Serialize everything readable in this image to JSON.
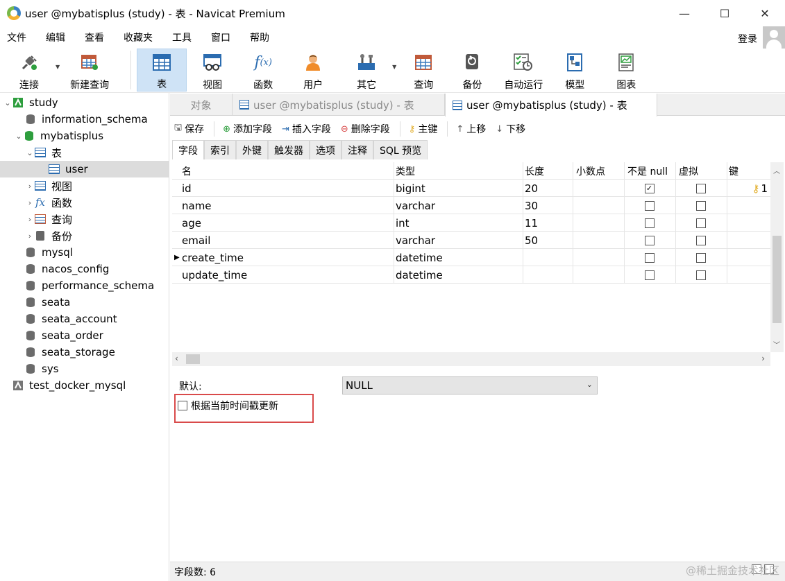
{
  "window": {
    "title": "user @mybatisplus (study) - 表 - Navicat Premium",
    "minimize": "—",
    "maximize": "☐",
    "close": "✕"
  },
  "menu": {
    "items": [
      "文件",
      "编辑",
      "查看",
      "收藏夹",
      "工具",
      "窗口",
      "帮助"
    ],
    "login": "登录"
  },
  "toolbar": {
    "connect": "连接",
    "new_query": "新建查询",
    "table": "表",
    "view": "视图",
    "function": "函数",
    "user": "用户",
    "other": "其它",
    "query": "查询",
    "backup": "备份",
    "autorun": "自动运行",
    "model": "模型",
    "chart": "图表"
  },
  "tree": {
    "items": [
      {
        "label": "study"
      },
      {
        "label": "information_schema"
      },
      {
        "label": "mybatisplus"
      },
      {
        "label": "表"
      },
      {
        "label": "user"
      },
      {
        "label": "视图"
      },
      {
        "label": "函数"
      },
      {
        "label": "查询"
      },
      {
        "label": "备份"
      },
      {
        "label": "mysql"
      },
      {
        "label": "nacos_config"
      },
      {
        "label": "performance_schema"
      },
      {
        "label": "seata"
      },
      {
        "label": "seata_account"
      },
      {
        "label": "seata_order"
      },
      {
        "label": "seata_storage"
      },
      {
        "label": "sys"
      },
      {
        "label": "test_docker_mysql"
      }
    ]
  },
  "tabs": {
    "objects": "对象",
    "tab1": "user @mybatisplus (study) - 表",
    "tab2": "user @mybatisplus (study) - 表"
  },
  "actions": {
    "save": "保存",
    "add_field": "添加字段",
    "insert_field": "插入字段",
    "delete_field": "删除字段",
    "primary_key": "主键",
    "move_up": "上移",
    "move_down": "下移"
  },
  "subtabs": [
    "字段",
    "索引",
    "外键",
    "触发器",
    "选项",
    "注释",
    "SQL 预览"
  ],
  "grid": {
    "headers": {
      "name": "名",
      "type": "类型",
      "length": "长度",
      "decimals": "小数点",
      "not_null": "不是 null",
      "virtual": "虚拟",
      "key": "键"
    },
    "rows": [
      {
        "name": "id",
        "type": "bigint",
        "length": "20",
        "not_null": true,
        "key": "1"
      },
      {
        "name": "name",
        "type": "varchar",
        "length": "30",
        "not_null": false,
        "key": ""
      },
      {
        "name": "age",
        "type": "int",
        "length": "11",
        "not_null": false,
        "key": ""
      },
      {
        "name": "email",
        "type": "varchar",
        "length": "50",
        "not_null": false,
        "key": ""
      },
      {
        "name": "create_time",
        "type": "datetime",
        "length": "",
        "not_null": false,
        "key": ""
      },
      {
        "name": "update_time",
        "type": "datetime",
        "length": "",
        "not_null": false,
        "key": ""
      }
    ]
  },
  "props": {
    "default_label": "默认:",
    "default_value": "NULL",
    "on_update_label": "根据当前时间戳更新"
  },
  "status": {
    "field_count": "字段数: 6",
    "watermark": "@稀土掘金技术社区"
  }
}
